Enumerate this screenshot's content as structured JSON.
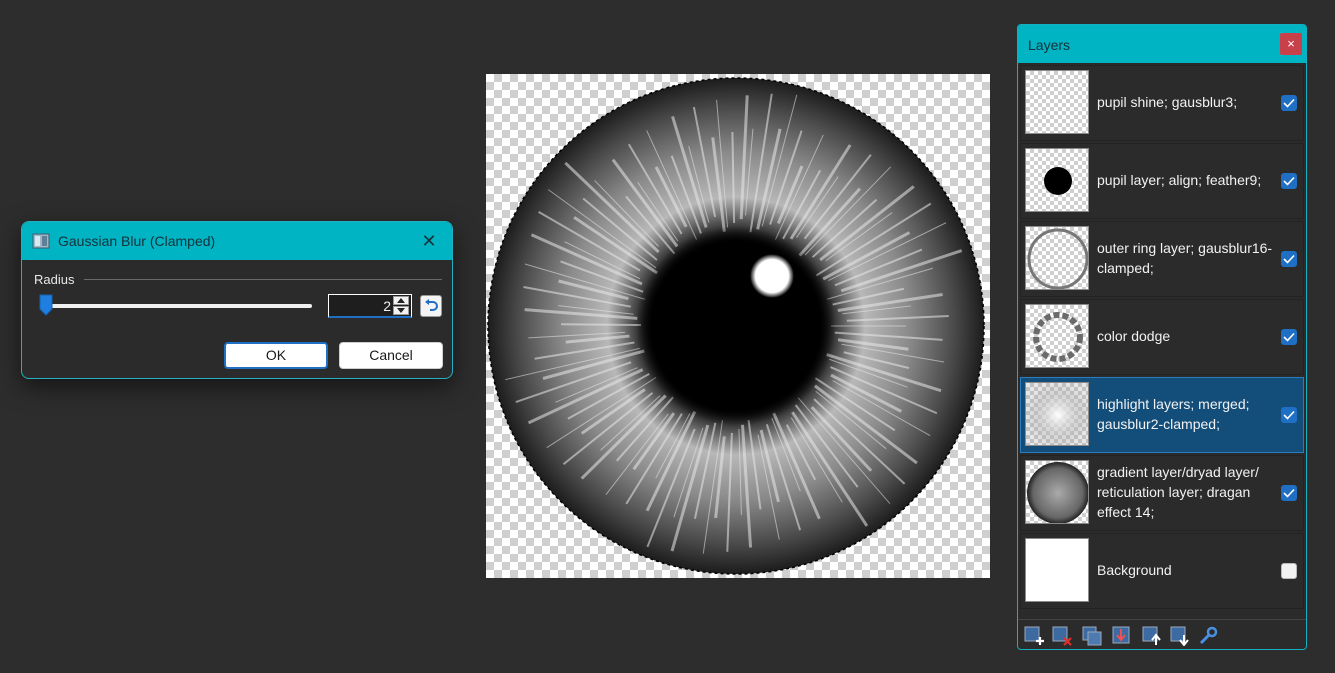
{
  "dialog": {
    "title": "Gaussian Blur (Clamped)",
    "radius_label": "Radius",
    "radius_value": "2",
    "ok_label": "OK",
    "cancel_label": "Cancel"
  },
  "layers_panel": {
    "title": "Layers",
    "close_label": "×",
    "layers": [
      {
        "name": "pupil shine; gausblur3;",
        "visible": true,
        "selected": false
      },
      {
        "name": "pupil layer; align; feather9;",
        "visible": true,
        "selected": false
      },
      {
        "name": "outer ring layer; gausblur16-clamped;",
        "visible": true,
        "selected": false
      },
      {
        "name": "color dodge",
        "visible": true,
        "selected": false
      },
      {
        "name": "highlight layers; merged; gausblur2-clamped;",
        "visible": true,
        "selected": true
      },
      {
        "name": "gradient layer/dryad layer/ reticulation layer; dragan effect 14;",
        "visible": true,
        "selected": false
      },
      {
        "name": "Background",
        "visible": false,
        "selected": false
      }
    ],
    "toolbar_icons": [
      "add-layer-icon",
      "delete-layer-icon",
      "duplicate-layer-icon",
      "merge-down-icon",
      "move-layer-up-icon",
      "move-layer-down-icon",
      "layer-properties-icon"
    ]
  },
  "colors": {
    "accent": "#00b4c4",
    "selection": "#134e7a",
    "check": "#1f6fc4"
  }
}
